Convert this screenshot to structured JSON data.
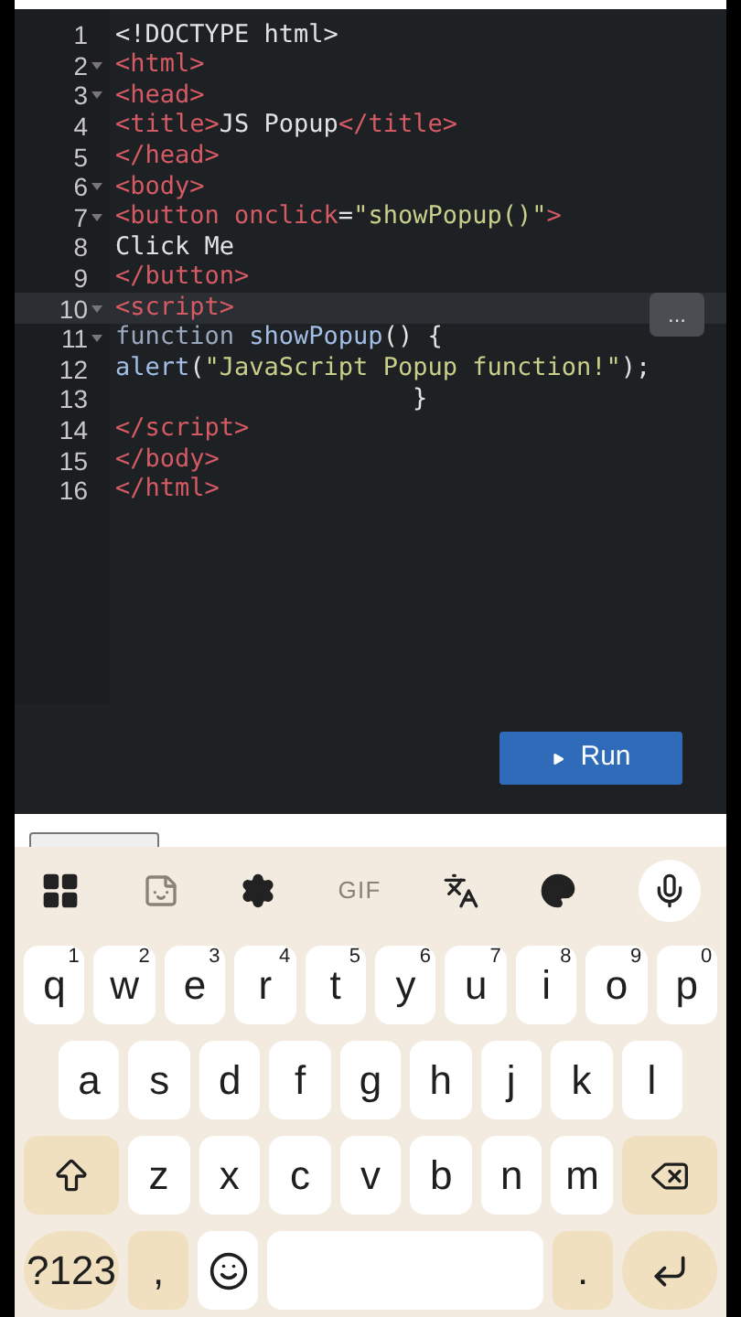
{
  "editor": {
    "lines": [
      {
        "number": "1",
        "fold": false,
        "active": false,
        "tokens": [
          {
            "kind": "text",
            "text": "<!DOCTYPE html>"
          }
        ]
      },
      {
        "number": "2",
        "fold": true,
        "active": false,
        "tokens": [
          {
            "kind": "tag",
            "text": "<html>"
          }
        ]
      },
      {
        "number": "3",
        "fold": true,
        "active": false,
        "tokens": [
          {
            "kind": "tag",
            "text": "<head>"
          }
        ]
      },
      {
        "number": "4",
        "fold": false,
        "active": false,
        "tokens": [
          {
            "kind": "tag",
            "text": "<title>"
          },
          {
            "kind": "text",
            "text": "JS Popup"
          },
          {
            "kind": "tag",
            "text": "</title>"
          }
        ]
      },
      {
        "number": "5",
        "fold": false,
        "active": false,
        "tokens": [
          {
            "kind": "tag",
            "text": "</head>"
          }
        ]
      },
      {
        "number": "6",
        "fold": true,
        "active": false,
        "tokens": [
          {
            "kind": "tag",
            "text": "<body>"
          }
        ]
      },
      {
        "number": "7",
        "fold": true,
        "active": false,
        "tokens": [
          {
            "kind": "tag",
            "text": "<button onclick"
          },
          {
            "kind": "text",
            "text": "="
          },
          {
            "kind": "string",
            "text": "\"showPopup()\""
          },
          {
            "kind": "tag",
            "text": ">"
          }
        ]
      },
      {
        "number": "8",
        "fold": false,
        "active": false,
        "tokens": [
          {
            "kind": "text",
            "text": "Click Me"
          }
        ]
      },
      {
        "number": "9",
        "fold": false,
        "active": false,
        "tokens": [
          {
            "kind": "tag",
            "text": "</button>"
          }
        ]
      },
      {
        "number": "10",
        "fold": true,
        "active": true,
        "tokens": [
          {
            "kind": "tag",
            "text": "<script>"
          }
        ]
      },
      {
        "number": "11",
        "fold": true,
        "active": false,
        "tokens": [
          {
            "kind": "keyword",
            "text": "function "
          },
          {
            "kind": "func",
            "text": "showPopup"
          },
          {
            "kind": "text",
            "text": "() {"
          }
        ]
      },
      {
        "number": "12",
        "fold": false,
        "active": false,
        "tokens": [
          {
            "kind": "func",
            "text": "alert"
          },
          {
            "kind": "text",
            "text": "("
          },
          {
            "kind": "string",
            "text": "\"JavaScript Popup function!\""
          },
          {
            "kind": "text",
            "text": ");"
          }
        ]
      },
      {
        "number": "13",
        "fold": false,
        "active": false,
        "tokens": [
          {
            "kind": "text",
            "text": "                    }"
          }
        ]
      },
      {
        "number": "14",
        "fold": false,
        "active": false,
        "tokens": [
          {
            "kind": "tag",
            "text": "</script>"
          }
        ]
      },
      {
        "number": "15",
        "fold": false,
        "active": false,
        "tokens": [
          {
            "kind": "tag",
            "text": "</body>"
          }
        ]
      },
      {
        "number": "16",
        "fold": false,
        "active": false,
        "tokens": [
          {
            "kind": "tag",
            "text": "</html>"
          }
        ]
      }
    ],
    "more_label": "...",
    "run_label": "Run"
  },
  "keyboard": {
    "gif_label": "GIF",
    "rows": [
      {
        "keys": [
          {
            "kind": "char",
            "label": "q",
            "hint": "1"
          },
          {
            "kind": "char",
            "label": "w",
            "hint": "2"
          },
          {
            "kind": "char",
            "label": "e",
            "hint": "3"
          },
          {
            "kind": "char",
            "label": "r",
            "hint": "4"
          },
          {
            "kind": "char",
            "label": "t",
            "hint": "5"
          },
          {
            "kind": "char",
            "label": "y",
            "hint": "6"
          },
          {
            "kind": "char",
            "label": "u",
            "hint": "7"
          },
          {
            "kind": "char",
            "label": "i",
            "hint": "8"
          },
          {
            "kind": "char",
            "label": "o",
            "hint": "9"
          },
          {
            "kind": "char",
            "label": "p",
            "hint": "0"
          }
        ]
      },
      {
        "keys": [
          {
            "kind": "char",
            "label": "a"
          },
          {
            "kind": "char",
            "label": "s"
          },
          {
            "kind": "char",
            "label": "d"
          },
          {
            "kind": "char",
            "label": "f"
          },
          {
            "kind": "char",
            "label": "g"
          },
          {
            "kind": "char",
            "label": "h"
          },
          {
            "kind": "char",
            "label": "j"
          },
          {
            "kind": "char",
            "label": "k"
          },
          {
            "kind": "char",
            "label": "l"
          }
        ]
      },
      {
        "keys": [
          {
            "kind": "shift"
          },
          {
            "kind": "char",
            "label": "z"
          },
          {
            "kind": "char",
            "label": "x"
          },
          {
            "kind": "char",
            "label": "c"
          },
          {
            "kind": "char",
            "label": "v"
          },
          {
            "kind": "char",
            "label": "b"
          },
          {
            "kind": "char",
            "label": "n"
          },
          {
            "kind": "char",
            "label": "m"
          },
          {
            "kind": "backspace"
          }
        ]
      },
      {
        "keys": [
          {
            "kind": "symbols",
            "label": "?123"
          },
          {
            "kind": "mod",
            "label": ","
          },
          {
            "kind": "emoji"
          },
          {
            "kind": "space"
          },
          {
            "kind": "mod",
            "label": "."
          },
          {
            "kind": "enter"
          }
        ]
      }
    ]
  }
}
